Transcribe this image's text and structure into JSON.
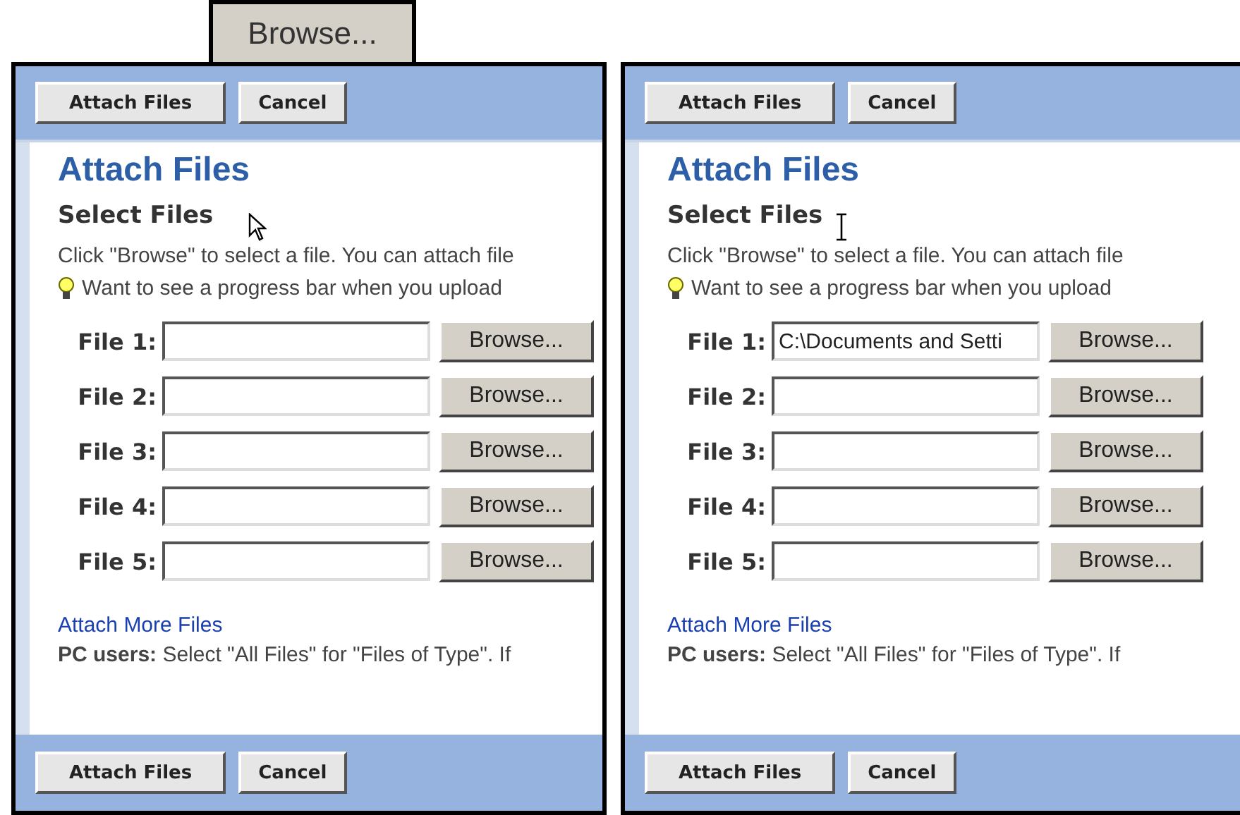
{
  "zoomed_button": {
    "label": "Browse..."
  },
  "panels": [
    {
      "cursor": {
        "kind": "arrow"
      },
      "top_buttons": [
        "Attach Files",
        "Cancel"
      ],
      "title": "Attach Files",
      "subtitle": "Select Files",
      "instructions": "Click \"Browse\" to select a file. You can attach file",
      "tip": "Want to see a progress bar when you upload",
      "files": [
        {
          "label": "File 1:",
          "button": "Browse..."
        },
        {
          "label": "File 2:",
          "button": "Browse..."
        },
        {
          "label": "File 3:",
          "button": "Browse..."
        },
        {
          "label": "File 4:",
          "button": "Browse..."
        },
        {
          "label": "File 5:",
          "button": "Browse..."
        }
      ],
      "more_link": "Attach More Files",
      "note": "**PC users:** Select \"All Files\" for \"Files of Type\". If",
      "bottom_buttons": [
        "Attach Files",
        "Cancel"
      ]
    },
    {
      "cursor": {
        "kind": "ibeam"
      },
      "top_buttons": [
        "Attach Files",
        "Cancel"
      ],
      "title": "Attach Files",
      "subtitle": "Select Files",
      "instructions": "Click \"Browse\" to select a file. You can attach file",
      "tip": "Want to see a progress bar when you upload",
      "files": [
        {
          "label": "File 1:",
          "value": "C:\\Documents and Setti",
          "button": "Browse..."
        },
        {
          "label": "File 2:",
          "button": "Browse..."
        },
        {
          "label": "File 3:",
          "button": "Browse..."
        },
        {
          "label": "File 4:",
          "button": "Browse..."
        },
        {
          "label": "File 5:",
          "button": "Browse..."
        }
      ],
      "more_link": "Attach More Files",
      "note": "**PC users:** Select \"All Files\" for \"Files of Type\". If",
      "bottom_buttons": [
        "Attach Files",
        "Cancel"
      ]
    }
  ]
}
